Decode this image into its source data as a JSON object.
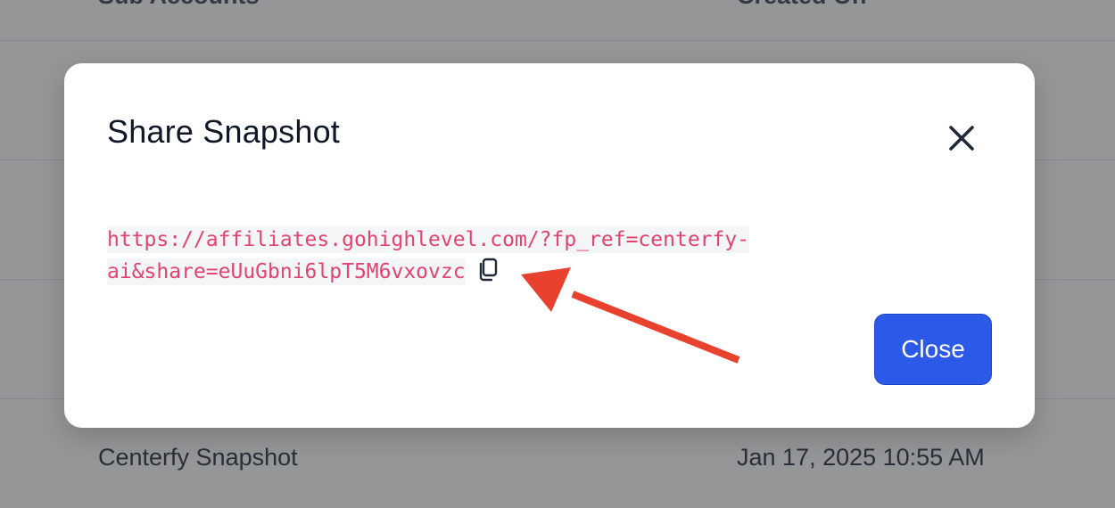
{
  "background_table": {
    "header": {
      "col1": "Sub Accounts",
      "col2": "Created On"
    },
    "rows": [
      {
        "name": "",
        "date": ""
      },
      {
        "name": "",
        "date": ""
      },
      {
        "name": "",
        "date": ""
      },
      {
        "name": "Centerfy Snapshot",
        "date": "Jan 17, 2025 10:55 AM"
      }
    ]
  },
  "modal": {
    "title": "Share Snapshot",
    "link_line1": "https://affiliates.gohighlevel.com/?fp_ref=centerfy-",
    "link_line2": "ai&share=eUuGbni6lpT5M6vxovzc",
    "close_button_label": "Close",
    "icons": {
      "close": "close-icon",
      "copy": "copy-icon"
    }
  },
  "annotation": {
    "color": "#e8412d"
  }
}
